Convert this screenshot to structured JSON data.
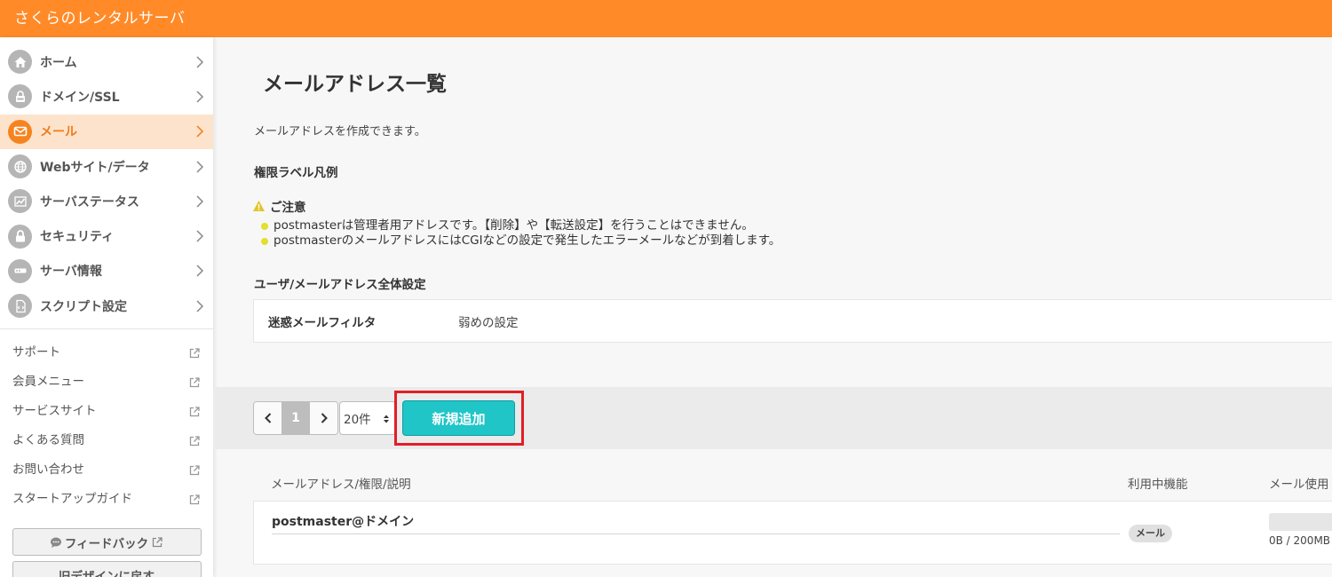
{
  "app": {
    "title": "さくらのレンタルサーバ"
  },
  "sidebar": {
    "nav": [
      {
        "label": "ホーム",
        "icon": "home-icon"
      },
      {
        "label": "ドメイン/SSL",
        "icon": "lock-icon"
      },
      {
        "label": "メール",
        "icon": "mail-icon",
        "active": true
      },
      {
        "label": "Webサイト/データ",
        "icon": "globe-icon"
      },
      {
        "label": "サーバステータス",
        "icon": "chart-icon"
      },
      {
        "label": "セキュリティ",
        "icon": "padlock-icon"
      },
      {
        "label": "サーバ情報",
        "icon": "server-icon"
      },
      {
        "label": "スクリプト設定",
        "icon": "script-icon"
      }
    ],
    "links": [
      {
        "label": "サポート"
      },
      {
        "label": "会員メニュー"
      },
      {
        "label": "サービスサイト"
      },
      {
        "label": "よくある質問"
      },
      {
        "label": "お問い合わせ"
      },
      {
        "label": "スタートアップガイド"
      }
    ],
    "feedback_label": "フィードバック",
    "old_design_label": "旧デザインに戻す"
  },
  "main": {
    "title": "メールアドレス一覧",
    "lead": "メールアドレスを作成できます。",
    "legend_heading": "権限ラベル凡例",
    "notice": {
      "heading": "ご注意",
      "items": [
        "postmasterは管理者用アドレスです。【削除】や【転送設定】を行うことはできません。",
        "postmasterのメールアドレスにはCGIなどの設定で発生したエラーメールなどが到着します。"
      ]
    },
    "settings": {
      "heading": "ユーザ/メールアドレス全体設定",
      "spam_label": "迷惑メールフィルタ",
      "spam_value": "弱めの設定"
    },
    "toolbar": {
      "current_page": "1",
      "per_page": "20件",
      "new_button": "新規追加"
    },
    "table": {
      "columns": [
        "メールアドレス/権限/説明",
        "利用中機能",
        "メール使用"
      ],
      "rows": [
        {
          "address": "postmaster@ドメイン",
          "feature": "メール",
          "usage": "0B / 200MB"
        }
      ]
    }
  },
  "colors": {
    "brand": "#ff8a27",
    "active_bg": "#fde3cc",
    "primary_button": "#20c5c8",
    "highlight": "#e31e25"
  }
}
